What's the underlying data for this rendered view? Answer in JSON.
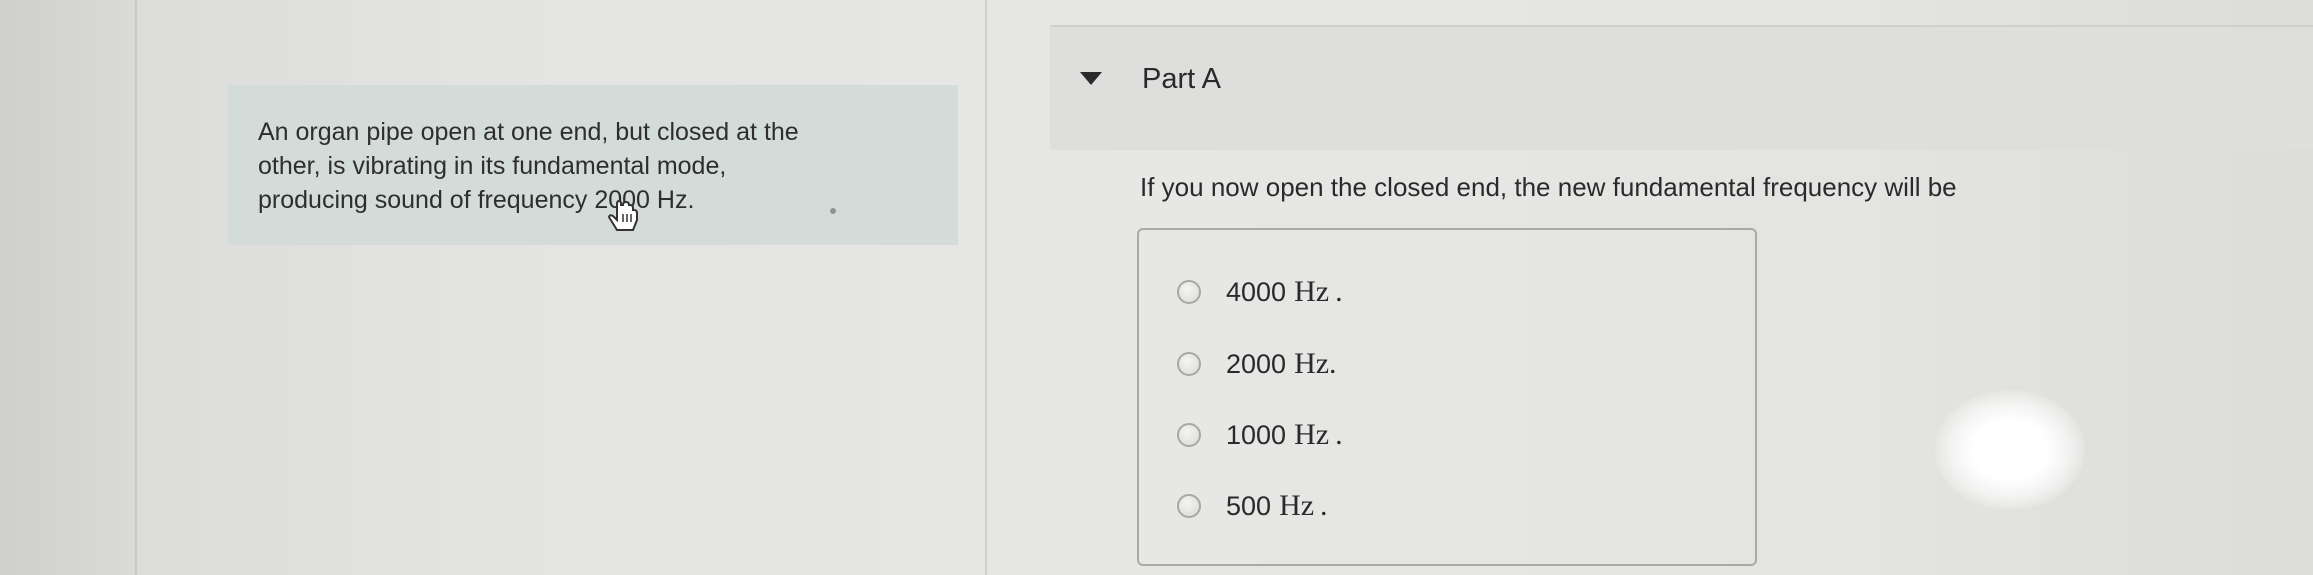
{
  "problem": {
    "lines": "An organ pipe open at one end, but closed at the\nother, is vibrating in its fundamental mode,\nproducing sound of frequency 2000 Hz."
  },
  "part": {
    "title": "Part A",
    "question": "If you now open the closed end, the new fundamental frequency will be"
  },
  "choices": [
    {
      "value": "4000",
      "unit": "Hz",
      "end": "."
    },
    {
      "value": "2000",
      "unit": "Hz.",
      "end": ""
    },
    {
      "value": "1000",
      "unit": "Hz",
      "end": "."
    },
    {
      "value": "500",
      "unit": "Hz",
      "end": "."
    }
  ],
  "icons": {
    "expand": "chevron-down-icon",
    "cursor": "hand-pointer-icon"
  }
}
